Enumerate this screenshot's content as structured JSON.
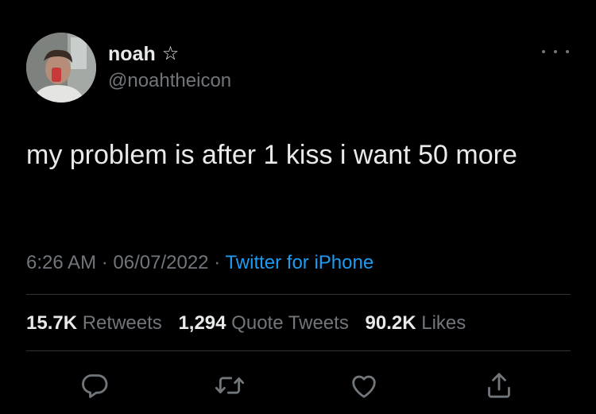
{
  "author": {
    "name": "noah",
    "badge_glyph": "☆",
    "handle": "@noahtheicon"
  },
  "tweet": {
    "text": "my problem is after 1 kiss i want 50 more",
    "time": "6:26 AM",
    "date": "06/07/2022",
    "source": "Twitter for iPhone",
    "separator": "·"
  },
  "stats": {
    "retweets_count": "15.7K",
    "retweets_label": "Retweets",
    "quotes_count": "1,294",
    "quotes_label": "Quote Tweets",
    "likes_count": "90.2K",
    "likes_label": "Likes"
  },
  "icons": {
    "reply": "reply-icon",
    "retweet": "retweet-icon",
    "like": "heart-icon",
    "share": "share-icon",
    "more": "more-options-icon"
  },
  "colors": {
    "background": "#000000",
    "text": "#e7e9ea",
    "secondary": "#71767b",
    "link": "#1d9bf0",
    "divider": "#2f3336"
  }
}
